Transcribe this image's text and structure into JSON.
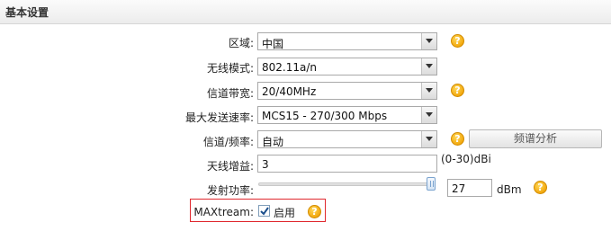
{
  "section": {
    "title": "基本设置"
  },
  "region": {
    "label": "区域:",
    "value": "中国"
  },
  "wireless_mode": {
    "label": "无线模式:",
    "value": "802.11a/n"
  },
  "channel_bandwidth": {
    "label": "信道带宽:",
    "value": "20/40MHz"
  },
  "max_tx_rate": {
    "label": "最大发送速率:",
    "value": "MCS15 - 270/300 Mbps"
  },
  "channel_frequency": {
    "label": "信道/频率:",
    "value": "自动",
    "spectrum_button": "频谱分析"
  },
  "antenna_gain": {
    "label": "天线增益:",
    "value": "3",
    "range": "(0-30)dBi"
  },
  "tx_power": {
    "label": "发射功率:",
    "value": "27",
    "unit": "dBm",
    "slider_level": 1.0
  },
  "maxtream": {
    "label": "MAXtream:",
    "checkbox_label": "启用",
    "checked": true
  },
  "icons": {
    "help": "help-icon",
    "dropdown": "chevron-down-icon",
    "check": "check-icon"
  },
  "colors": {
    "help_icon": "#f3a90f",
    "highlight_border": "#e0282e",
    "slider_thumb": "#7aa3cf"
  }
}
